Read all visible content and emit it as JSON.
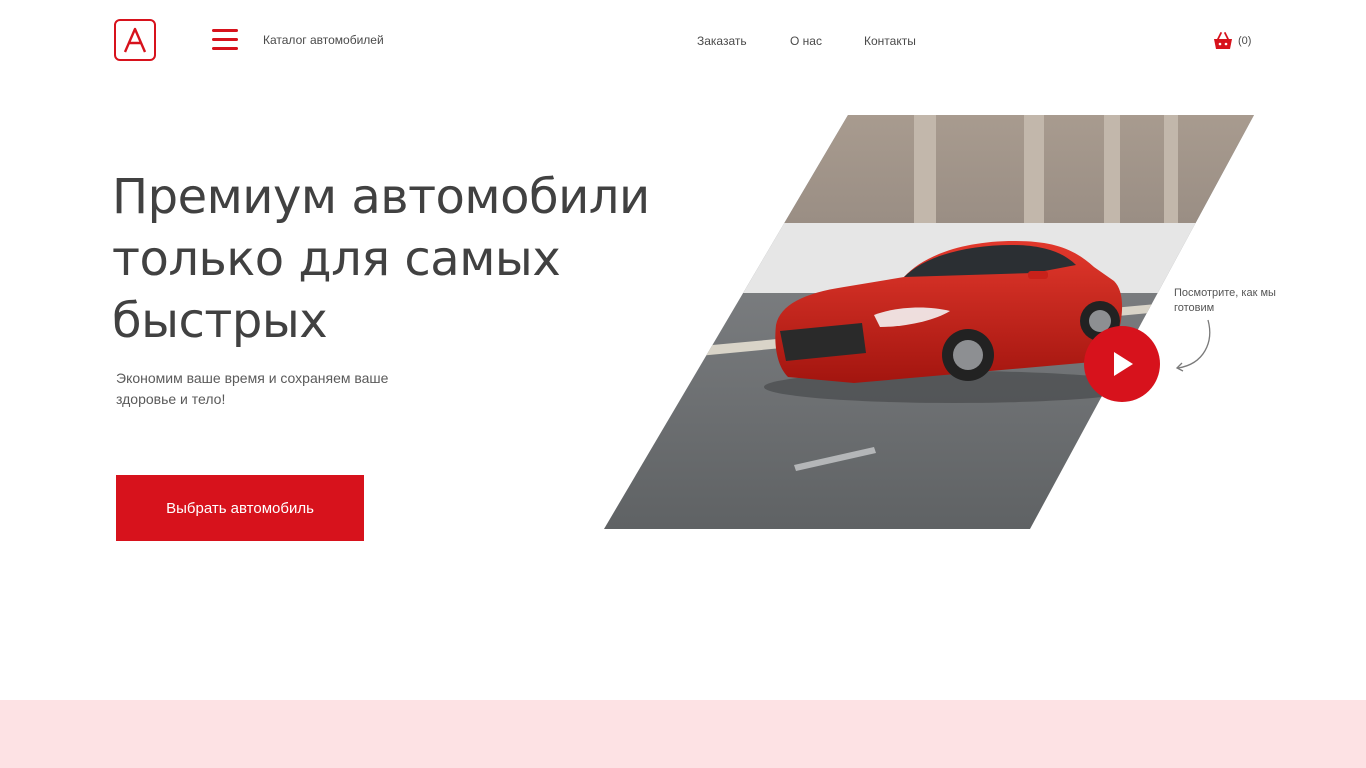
{
  "brand": {
    "logo_letter": "A",
    "accent": "#d7121c",
    "band_color": "#fde2e4"
  },
  "header": {
    "menu_icon": "hamburger-icon",
    "catalog_label": "Каталог автомобилей",
    "nav": [
      {
        "label": "Заказать"
      },
      {
        "label": "О нас"
      },
      {
        "label": "Контакты"
      }
    ],
    "cart": {
      "icon": "basket-icon",
      "count_label": "(0)"
    }
  },
  "hero": {
    "title": "Премиум автомобили только для самых быстрых",
    "subtitle": "Экономим ваше время и сохраняем ваше здоровье и тело!",
    "cta_label": "Выбрать автомобиль",
    "image": "red-sports-car-photo",
    "play_icon": "play-icon",
    "play_hint": "Посмотрите, как мы готовим"
  }
}
